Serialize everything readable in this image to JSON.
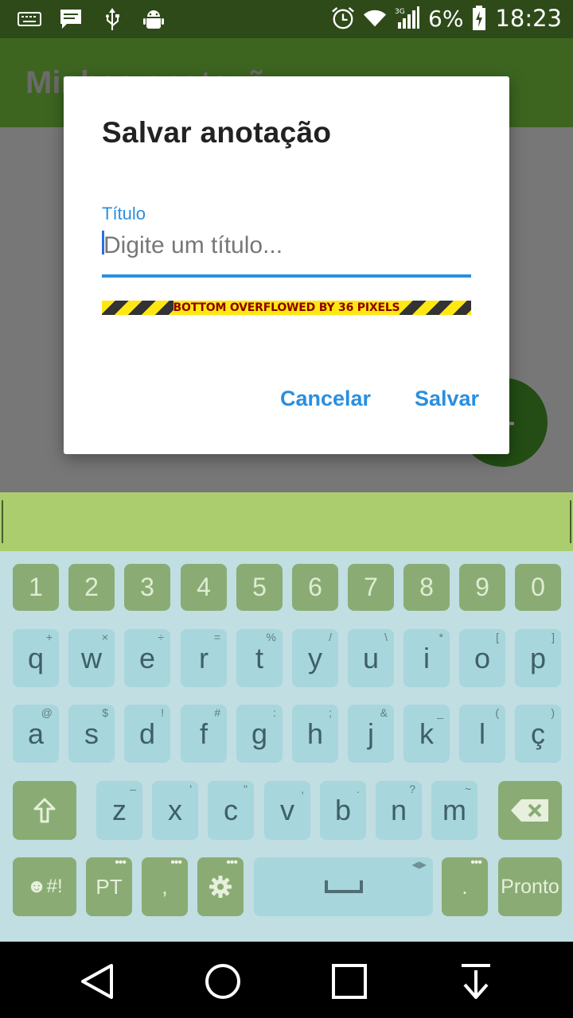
{
  "status_bar": {
    "battery_percent": "6%",
    "network_type": "3G",
    "time": "18:23",
    "left_icons": [
      "keyboard-icon",
      "message-icon",
      "usb-icon",
      "android-debug-icon"
    ],
    "right_icons": [
      "alarm-icon",
      "wifi-icon",
      "signal-icon",
      "battery-charging-icon"
    ]
  },
  "app_bar": {
    "title_partial": "Minhas anotaçõ"
  },
  "dialog": {
    "title": "Salvar anotação",
    "field_label": "Título",
    "field_placeholder": "Digite um título...",
    "field_value": "",
    "overflow_warning": "BOTTOM OVERFLOWED BY 36 PIXELS",
    "cancel_label": "Cancelar",
    "save_label": "Salvar"
  },
  "keyboard": {
    "numbers": [
      "1",
      "2",
      "3",
      "4",
      "5",
      "6",
      "7",
      "8",
      "9",
      "0"
    ],
    "row1": [
      [
        "q",
        "+"
      ],
      [
        "w",
        "×"
      ],
      [
        "e",
        "÷"
      ],
      [
        "r",
        "="
      ],
      [
        "t",
        "%"
      ],
      [
        "y",
        "/"
      ],
      [
        "u",
        "\\"
      ],
      [
        "i",
        "*"
      ],
      [
        "o",
        "["
      ],
      [
        "p",
        "]"
      ]
    ],
    "row2": [
      [
        "a",
        "@"
      ],
      [
        "s",
        "$"
      ],
      [
        "d",
        "!"
      ],
      [
        "f",
        "#"
      ],
      [
        "g",
        ":"
      ],
      [
        "h",
        ";"
      ],
      [
        "j",
        "&"
      ],
      [
        "k",
        "_"
      ],
      [
        "l",
        "("
      ],
      [
        "ç",
        ")"
      ]
    ],
    "row3": [
      [
        "z",
        "–"
      ],
      [
        "x",
        "'"
      ],
      [
        "c",
        "\""
      ],
      [
        "v",
        ","
      ],
      [
        "b",
        "."
      ],
      [
        "n",
        "?"
      ],
      [
        "m",
        "~"
      ]
    ],
    "emoji_label": "☻#!",
    "lang_label": "PT",
    "comma_label": ",",
    "period_label": ".",
    "done_label": "Pronto"
  },
  "colors": {
    "status_bar": "#2e4a19",
    "app_bar": "#3d6520",
    "accent": "#2a8fe0",
    "keyboard_bg": "#c1dee2",
    "keyboard_topbar": "#abcd6e"
  }
}
